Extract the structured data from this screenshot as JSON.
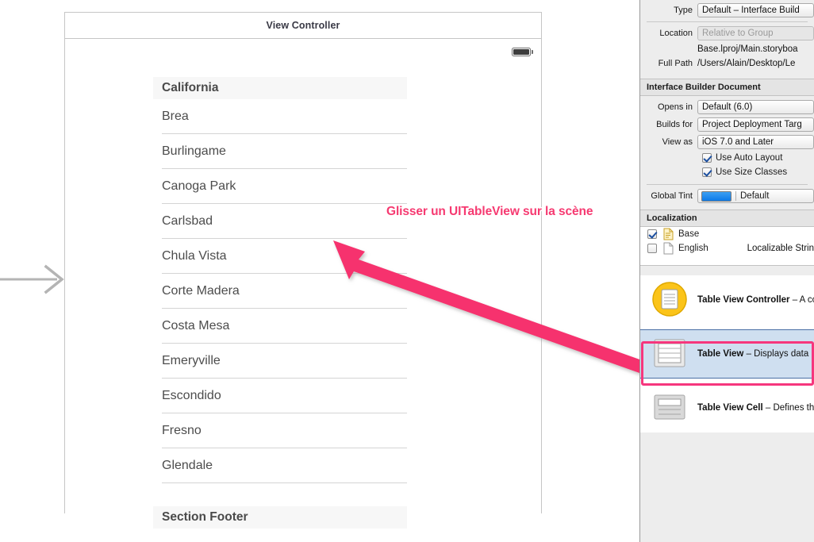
{
  "canvas": {
    "scene_title": "View Controller",
    "entry_arrow_icon": "entry-point-arrow-icon",
    "battery_icon": "battery-full-icon",
    "table": {
      "section_header": "California",
      "cells": [
        "Brea",
        "Burlingame",
        "Canoga Park",
        "Carlsbad",
        "Chula Vista",
        "Corte Madera",
        "Costa Mesa",
        "Emeryville",
        "Escondido",
        "Fresno",
        "Glendale"
      ],
      "section_footer": "Section Footer"
    }
  },
  "annotation": {
    "text": "Glisser un UITableView sur la scène",
    "color": "#f63a71",
    "arrow_icon": "annotation-arrow-icon",
    "highlight_color": "#f6367d"
  },
  "inspector": {
    "file_section": {
      "type_label": "Type",
      "type_value": "Default – Interface Build",
      "location_label": "Location",
      "location_value": "Relative to Group",
      "path_value": "Base.lproj/Main.storyboa",
      "full_path_label": "Full Path",
      "full_path_value": "/Users/Alain/Desktop/Le"
    },
    "ib_document": {
      "title": "Interface Builder Document",
      "opens_in_label": "Opens in",
      "opens_in_value": "Default (6.0)",
      "builds_for_label": "Builds for",
      "builds_for_value": "Project Deployment Targ",
      "view_as_label": "View as",
      "view_as_value": "iOS 7.0 and Later",
      "auto_layout_label": "Use Auto Layout",
      "auto_layout_checked": true,
      "size_classes_label": "Use Size Classes",
      "size_classes_checked": true,
      "global_tint_label": "Global Tint",
      "global_tint_value": "Default",
      "global_tint_color": "#1d82e8"
    },
    "localization": {
      "title": "Localization",
      "rows": [
        {
          "name": "Base",
          "type": "",
          "checked": true
        },
        {
          "name": "English",
          "type": "Localizable Strin",
          "checked": false
        }
      ]
    },
    "library": {
      "items": [
        {
          "title": "Table View Controller",
          "desc": " – A co",
          "icon": "table-view-controller-icon",
          "selected": false
        },
        {
          "title": "Table View",
          "desc": " – Displays data in a",
          "icon": "table-view-icon",
          "selected": true
        },
        {
          "title": "Table View Cell",
          "desc": " – Defines the a",
          "icon": "table-view-cell-icon",
          "selected": false
        }
      ]
    }
  }
}
